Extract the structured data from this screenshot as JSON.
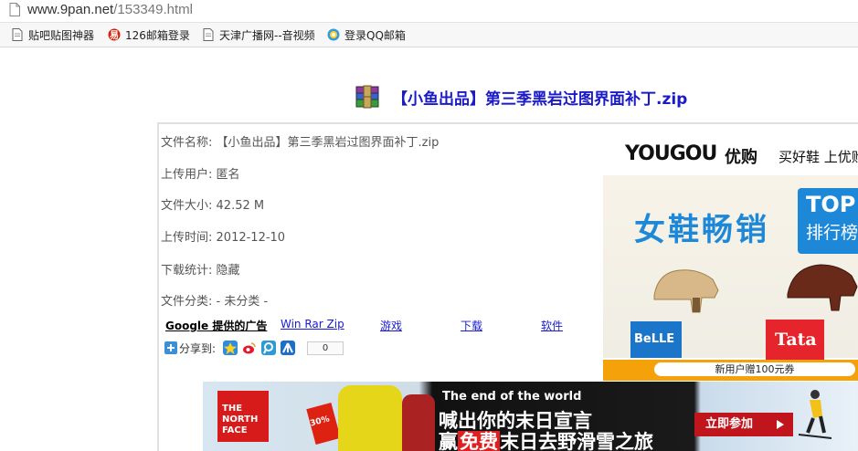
{
  "browser": {
    "url_host": "www.9pan.net",
    "url_path": "/153349.html"
  },
  "bookmarks": [
    {
      "label": "贴吧贴图神器",
      "icon": "bookmark-page-icon"
    },
    {
      "label": "126邮箱登录",
      "icon": "netease-icon"
    },
    {
      "label": "天津广播网--音视频",
      "icon": "bookmark-page-icon"
    },
    {
      "label": "登录QQ邮箱",
      "icon": "qq-browser-icon"
    }
  ],
  "file": {
    "title": "【小鱼出品】第三季黑岩过图界面补丁.zip",
    "fields": [
      {
        "label": "文件名称:",
        "value": "【小鱼出品】第三季黑岩过图界面补丁.zip"
      },
      {
        "label": "上传用户:",
        "value": "匿名"
      },
      {
        "label": "文件大小:",
        "value": "42.52 M"
      },
      {
        "label": "上传时间:",
        "value": "2012-12-10"
      },
      {
        "label": "下载统计:",
        "value": "隐藏"
      },
      {
        "label": "文件分类:",
        "value": "- 未分类 -"
      }
    ]
  },
  "ads_links": {
    "google_label": "Google 提供的广告",
    "links": [
      "Win Rar Zip",
      "游戏",
      "下载",
      "软件"
    ]
  },
  "share": {
    "label": "分享到:",
    "count": "0"
  },
  "right_ad": {
    "brand_en": "YOUGOU",
    "brand_cn": "优购",
    "slogan": "买好鞋 上优购",
    "headline": "女鞋畅销",
    "top_label": "TOP",
    "rank_label": "排行榜",
    "belle": "BeLLE",
    "tata": "Tata",
    "promo": "新用户赠100元券"
  },
  "bottom_ad": {
    "brand": "THE NORTH FACE",
    "tagline_en": "The end of the world",
    "line1": "喊出你的末日宣言",
    "line2_prefix": "赢",
    "line2_free": "免费",
    "line2_rest": "末日去野滑雪之旅",
    "cta": "立即参加",
    "discount": "30%"
  }
}
